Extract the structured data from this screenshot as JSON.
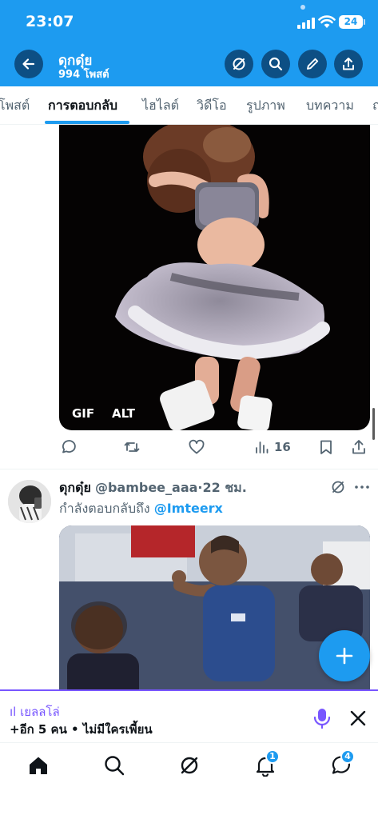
{
  "status_bar": {
    "time": "23:07",
    "battery": "24"
  },
  "header": {
    "name": "ดุกดุ๋ย",
    "post_count": "994 โพสต์",
    "icons": [
      "back-arrow-icon",
      "grok-icon",
      "search-icon",
      "pencil-icon",
      "share-icon"
    ]
  },
  "tabs": [
    {
      "label": "โพสต์"
    },
    {
      "label": "การตอบกลับ",
      "active": true
    },
    {
      "label": "ไฮไลต์"
    },
    {
      "label": "วิดีโอ"
    },
    {
      "label": "รูปภาพ"
    },
    {
      "label": "บทความ"
    },
    {
      "label": "ถ"
    }
  ],
  "media1": {
    "gif_label": "GIF",
    "alt_label": "ALT"
  },
  "post1_actions": {
    "views": "16"
  },
  "post2": {
    "name": "ดุกดุ๋ย",
    "handle": "@bambee_aaa",
    "separator": "·",
    "time": "22 ชม.",
    "reply_prefix": "กำลังตอบกลับถึง",
    "reply_to": "@Imteerx"
  },
  "space": {
    "indicator": "ıl",
    "title": "เยลลโล่",
    "subtitle": "+อีก 5 คน • ไม่มีใครเพี้ยน"
  },
  "bottom_nav": {
    "notifications_badge": "1",
    "messages_badge": "4"
  },
  "colors": {
    "brand_blue": "#1d9bf0",
    "header_button": "#0d4f84",
    "space_purple": "#7856ff",
    "muted_text": "#536471"
  }
}
